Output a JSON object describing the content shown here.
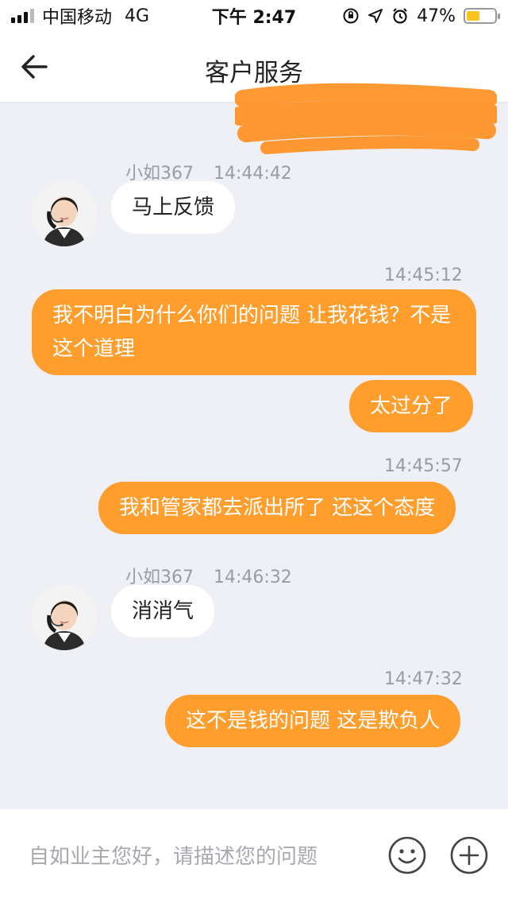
{
  "status_bar": {
    "carrier": "中国移动",
    "network": "4G",
    "time": "下午 2:47",
    "battery_percent": "47%",
    "battery_level": 0.47
  },
  "header": {
    "title": "客户服务"
  },
  "messages": [
    {
      "type": "in",
      "sender": "小如367",
      "time": "14:44:42",
      "text": "马上反馈"
    },
    {
      "type": "out",
      "time": "14:45:12",
      "text": "我不明白为什么你们的问题 让我花钱？不是这个道理"
    },
    {
      "type": "out",
      "text": "太过分了"
    },
    {
      "type": "out",
      "time": "14:45:57",
      "text": "我和管家都去派出所了 还这个态度"
    },
    {
      "type": "in",
      "sender": "小如367",
      "time": "14:46:32",
      "text": "消消气"
    },
    {
      "type": "out",
      "time": "14:47:32",
      "text": "这不是钱的问题 这是欺负人"
    }
  ],
  "input": {
    "placeholder": "自如业主您好，请描述您的问题",
    "value": ""
  },
  "icons": {
    "back": "back-arrow-icon",
    "emoji": "smiley-icon",
    "add": "plus-circle-icon"
  },
  "colors": {
    "accent": "#ff9d2d",
    "background": "#eef0f5"
  }
}
